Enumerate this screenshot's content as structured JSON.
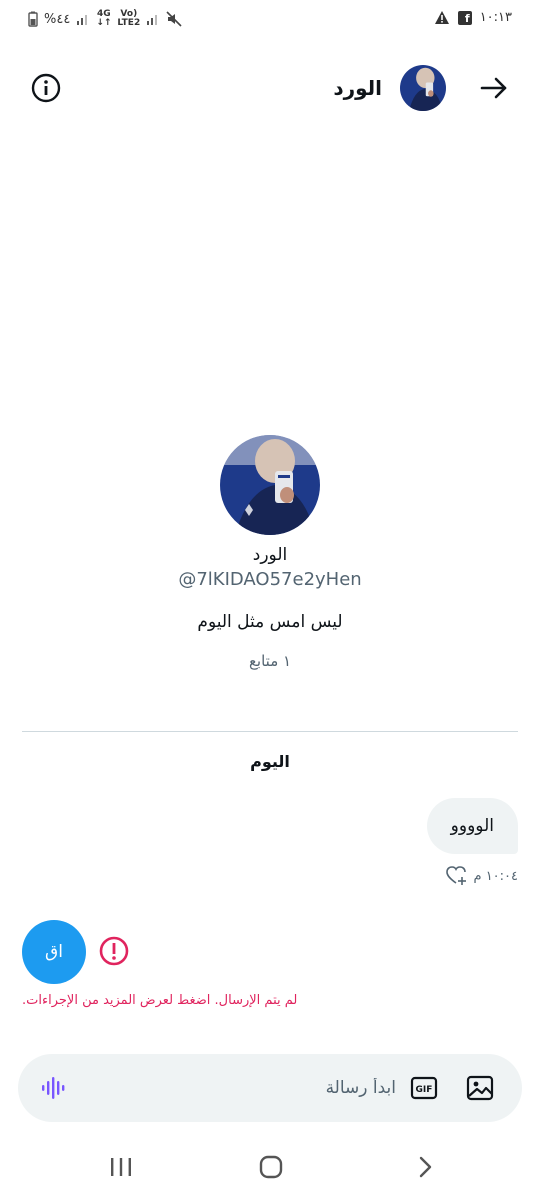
{
  "status_bar": {
    "time": "١٠:١٣",
    "battery": "%٤٤",
    "network_top": "4G",
    "network_bottom": "LTE2",
    "volte": "Vo)",
    "fb_glyph": "f"
  },
  "header": {
    "name": "الورد"
  },
  "profile": {
    "name": "الورد",
    "handle": "@7lKIDAO57e2yHen",
    "bio": "ليس امس مثل اليوم",
    "followers": "١ متابع"
  },
  "conversation": {
    "day_label": "اليوم",
    "messages": [
      {
        "text": "الوووو",
        "time": "١٠:٠٤ م"
      }
    ],
    "failed_message": {
      "text": "اق",
      "error": "لم يتم الإرسال. اضغط لعرض المزيد من الإجراءات."
    }
  },
  "composer": {
    "placeholder": "ابدأ رسالة",
    "gif_label": "GIF"
  },
  "colors": {
    "accent": "#1d9bf0",
    "error": "#e0245e",
    "voice": "#7856ff",
    "bubble": "#eff3f4"
  }
}
